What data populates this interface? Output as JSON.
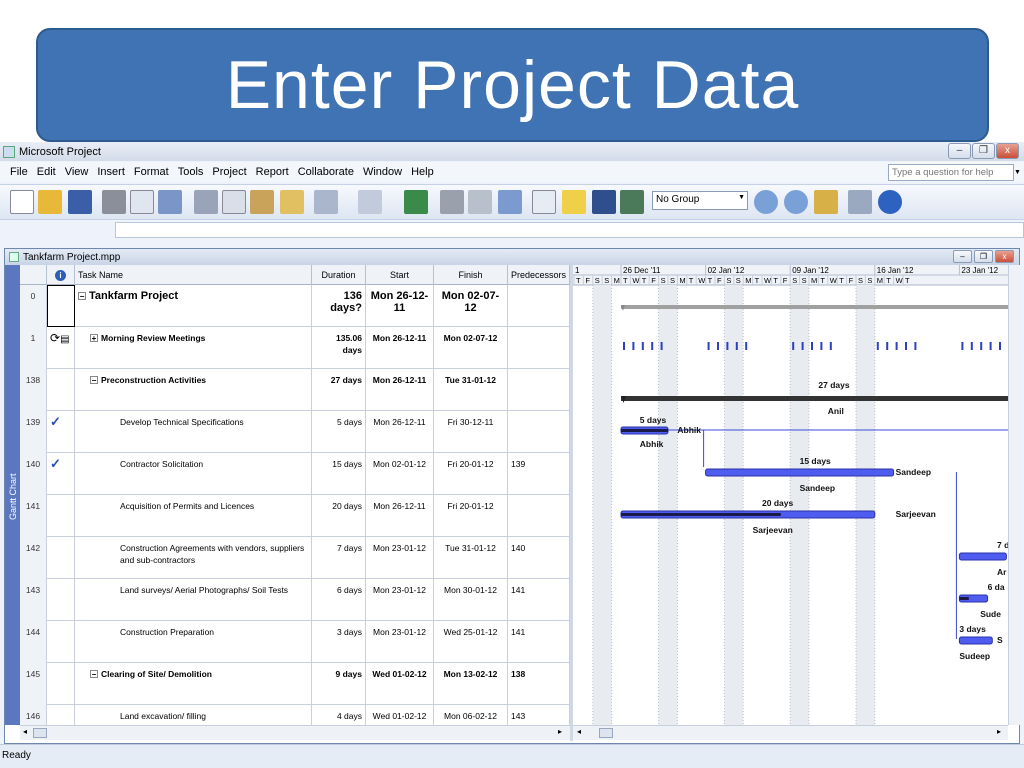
{
  "banner": {
    "title": "Enter Project Data"
  },
  "window": {
    "title": "Microsoft Project",
    "minimize": "–",
    "restore": "❐",
    "close": "x"
  },
  "menu": [
    "File",
    "Edit",
    "View",
    "Insert",
    "Format",
    "Tools",
    "Project",
    "Report",
    "Collaborate",
    "Window",
    "Help"
  ],
  "help_box": {
    "placeholder": "Type a question for help"
  },
  "toolbar": {
    "group_select": "No Group"
  },
  "document": {
    "title": "Tankfarm Project.mpp",
    "view_name": "Gantt Chart"
  },
  "columns": {
    "indicator": "i",
    "name": "Task Name",
    "duration": "Duration",
    "start": "Start",
    "finish": "Finish",
    "predecessors": "Predecessors"
  },
  "tasks": [
    {
      "id": "0",
      "name": "Tankfarm Project",
      "duration": "136 days?",
      "start": "Mon 26-12-11",
      "finish": "Mon 02-07-12",
      "pred": "",
      "level": 0,
      "summary": true,
      "sign": "−"
    },
    {
      "id": "1",
      "name": "Morning Review Meetings",
      "duration": "135.06 days",
      "start": "Mon 26-12-11",
      "finish": "Mon 02-07-12",
      "pred": "",
      "level": 1,
      "summary": true,
      "sign": "+"
    },
    {
      "id": "138",
      "name": "Preconstruction Activities",
      "duration": "27 days",
      "start": "Mon 26-12-11",
      "finish": "Tue 31-01-12",
      "pred": "",
      "level": 1,
      "summary": true,
      "sign": "−"
    },
    {
      "id": "139",
      "name": "Develop Technical Specifications",
      "duration": "5 days",
      "start": "Mon 26-12-11",
      "finish": "Fri 30-12-11",
      "pred": "",
      "level": 2,
      "summary": false,
      "check": true
    },
    {
      "id": "140",
      "name": "Contractor Solicitation",
      "duration": "15 days",
      "start": "Mon 02-01-12",
      "finish": "Fri 20-01-12",
      "pred": "139",
      "level": 2,
      "summary": false,
      "check": true
    },
    {
      "id": "141",
      "name": "Acquisition of Permits and Licences",
      "duration": "20 days",
      "start": "Mon 26-12-11",
      "finish": "Fri 20-01-12",
      "pred": "",
      "level": 2,
      "summary": false
    },
    {
      "id": "142",
      "name": "Construction Agreements with vendors, suppliers and sub-contractors",
      "duration": "7 days",
      "start": "Mon 23-01-12",
      "finish": "Tue 31-01-12",
      "pred": "140",
      "level": 2,
      "summary": false
    },
    {
      "id": "143",
      "name": "Land surveys/ Aerial Photographs/ Soil Tests",
      "duration": "6 days",
      "start": "Mon 23-01-12",
      "finish": "Mon 30-01-12",
      "pred": "141",
      "level": 2,
      "summary": false
    },
    {
      "id": "144",
      "name": "Construction Preparation",
      "duration": "3 days",
      "start": "Mon 23-01-12",
      "finish": "Wed 25-01-12",
      "pred": "141",
      "level": 2,
      "summary": false
    },
    {
      "id": "145",
      "name": "Clearing of Site/ Demolition",
      "duration": "9 days",
      "start": "Wed 01-02-12",
      "finish": "Mon 13-02-12",
      "pred": "138",
      "level": 1,
      "summary": true,
      "sign": "−"
    },
    {
      "id": "146",
      "name": "Land excavation/ filling",
      "duration": "4 days",
      "start": "Wed 01-02-12",
      "finish": "Mon 06-02-12",
      "pred": "143",
      "level": 2,
      "summary": false
    }
  ],
  "gantt": {
    "weeks": [
      "1",
      "26 Dec '11",
      "02 Jan '12",
      "09 Jan '12",
      "16 Jan '12",
      "23 Jan '12"
    ],
    "day_letters": [
      "T",
      "F",
      "S",
      "S",
      "M",
      "T",
      "W",
      "T",
      "F",
      "S",
      "S",
      "M",
      "T",
      "W",
      "T",
      "F",
      "S",
      "S",
      "M",
      "T",
      "W",
      "T",
      "F",
      "S",
      "S",
      "M",
      "T",
      "W",
      "T",
      "F",
      "S",
      "S",
      "M",
      "T",
      "W",
      "T"
    ],
    "bar_labels": [
      {
        "text": "27 days",
        "row": 2,
        "pos": "above"
      },
      {
        "text": "Anil",
        "row": 2,
        "pos": "below"
      },
      {
        "text": "5 days",
        "row": 3,
        "pos": "above"
      },
      {
        "text": "Abhik",
        "row": 3,
        "pos": "right"
      },
      {
        "text": "Abhik",
        "row": 3,
        "pos": "below"
      },
      {
        "text": "15 days",
        "row": 4,
        "pos": "above"
      },
      {
        "text": "Sandeep",
        "row": 4,
        "pos": "right"
      },
      {
        "text": "Sandeep",
        "row": 4,
        "pos": "below"
      },
      {
        "text": "20 days",
        "row": 5,
        "pos": "above"
      },
      {
        "text": "Sarjeevan",
        "row": 5,
        "pos": "right"
      },
      {
        "text": "Sarjeevan",
        "row": 5,
        "pos": "below"
      },
      {
        "text": "7 d",
        "row": 6,
        "pos": "above"
      },
      {
        "text": "Ar",
        "row": 6,
        "pos": "below"
      },
      {
        "text": "6 da",
        "row": 7,
        "pos": "above"
      },
      {
        "text": "Sude",
        "row": 7,
        "pos": "below"
      },
      {
        "text": "3 days",
        "row": 8,
        "pos": "above"
      },
      {
        "text": "S",
        "row": 8,
        "pos": "right"
      },
      {
        "text": "Sudeep",
        "row": 8,
        "pos": "below"
      }
    ]
  },
  "status": {
    "text": "Ready"
  },
  "colors": {
    "banner": "#3f73b4",
    "task_bar": "#4f5cf0",
    "summary_bar": "#333333",
    "sidebar": "#5b77bf"
  }
}
